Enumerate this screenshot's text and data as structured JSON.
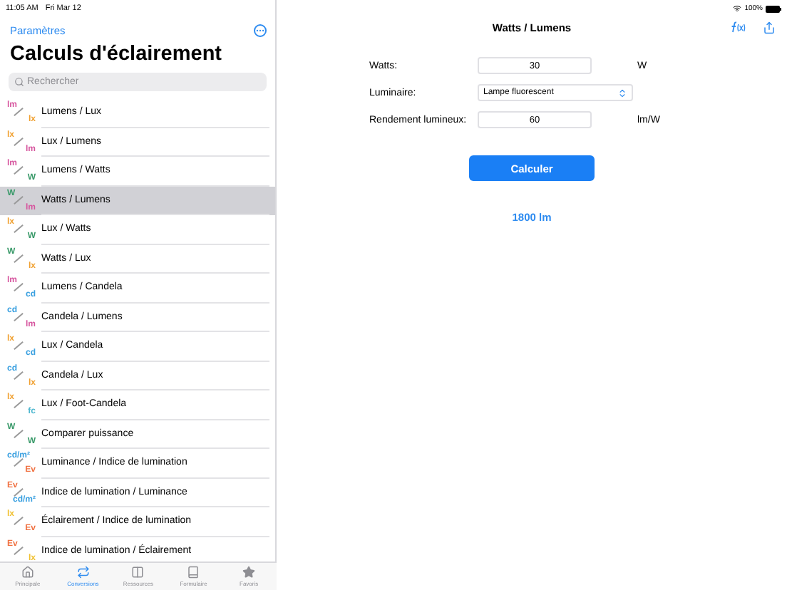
{
  "status_bar": {
    "time": "11:05 AM",
    "date": "Fri Mar 12",
    "battery": "100%"
  },
  "sidebar": {
    "back_link": "Paramètres",
    "title": "Calculs d'éclairement",
    "search": {
      "placeholder": "Rechercher"
    },
    "items": [
      {
        "label": "Lumens / Lux",
        "top": {
          "text": "lm",
          "color": "#d6559e"
        },
        "bottom": {
          "text": "lx",
          "color": "#f0a030"
        },
        "selected": false
      },
      {
        "label": "Lux / Lumens",
        "top": {
          "text": "lx",
          "color": "#f0a030"
        },
        "bottom": {
          "text": "lm",
          "color": "#d6559e"
        },
        "selected": false
      },
      {
        "label": "Lumens / Watts",
        "top": {
          "text": "lm",
          "color": "#d6559e"
        },
        "bottom": {
          "text": "W",
          "color": "#3a9a6a"
        },
        "selected": false
      },
      {
        "label": "Watts / Lumens",
        "top": {
          "text": "W",
          "color": "#3a9a6a"
        },
        "bottom": {
          "text": "lm",
          "color": "#d6559e"
        },
        "selected": true
      },
      {
        "label": "Lux / Watts",
        "top": {
          "text": "lx",
          "color": "#f0a030"
        },
        "bottom": {
          "text": "W",
          "color": "#3a9a6a"
        },
        "selected": false
      },
      {
        "label": "Watts / Lux",
        "top": {
          "text": "W",
          "color": "#3a9a6a"
        },
        "bottom": {
          "text": "lx",
          "color": "#f0a030"
        },
        "selected": false
      },
      {
        "label": "Lumens / Candela",
        "top": {
          "text": "lm",
          "color": "#d6559e"
        },
        "bottom": {
          "text": "cd",
          "color": "#3aa0e0"
        },
        "selected": false
      },
      {
        "label": "Candela / Lumens",
        "top": {
          "text": "cd",
          "color": "#3aa0e0"
        },
        "bottom": {
          "text": "lm",
          "color": "#d6559e"
        },
        "selected": false
      },
      {
        "label": "Lux / Candela",
        "top": {
          "text": "lx",
          "color": "#f0a030"
        },
        "bottom": {
          "text": "cd",
          "color": "#3aa0e0"
        },
        "selected": false
      },
      {
        "label": "Candela / Lux",
        "top": {
          "text": "cd",
          "color": "#3aa0e0"
        },
        "bottom": {
          "text": "lx",
          "color": "#f0a030"
        },
        "selected": false
      },
      {
        "label": "Lux / Foot-Candela",
        "top": {
          "text": "lx",
          "color": "#f0a030"
        },
        "bottom": {
          "text": "fc",
          "color": "#50b8d0"
        },
        "selected": false
      },
      {
        "label": "Comparer puissance",
        "top": {
          "text": "W",
          "color": "#3a9a6a"
        },
        "bottom": {
          "text": "W",
          "color": "#3a9a6a"
        },
        "selected": false
      },
      {
        "label": "Luminance / Indice de lumination",
        "top": {
          "text": "cd/m²",
          "color": "#3aa0e0"
        },
        "bottom": {
          "text": "Ev",
          "color": "#f07040"
        },
        "selected": false
      },
      {
        "label": "Indice de lumination / Luminance",
        "top": {
          "text": "Ev",
          "color": "#f07040"
        },
        "bottom": {
          "text": "cd/m²",
          "color": "#3aa0e0"
        },
        "selected": false
      },
      {
        "label": "Éclairement / Indice de lumination",
        "top": {
          "text": "lx",
          "color": "#f0c030"
        },
        "bottom": {
          "text": "Ev",
          "color": "#f07040"
        },
        "selected": false
      },
      {
        "label": "Indice de lumination / Éclairement",
        "top": {
          "text": "Ev",
          "color": "#f07040"
        },
        "bottom": {
          "text": "lx",
          "color": "#f0c030"
        },
        "selected": false
      }
    ]
  },
  "tab_bar": [
    {
      "label": "Principale",
      "selected": false,
      "kind": "home"
    },
    {
      "label": "Conversions",
      "selected": true,
      "kind": "convert"
    },
    {
      "label": "Ressources",
      "selected": false,
      "kind": "table"
    },
    {
      "label": "Formulaire",
      "selected": false,
      "kind": "book"
    },
    {
      "label": "Favoris",
      "selected": false,
      "kind": "star"
    }
  ],
  "detail": {
    "title": "Watts / Lumens",
    "fields": [
      {
        "kind": "input",
        "label": "Watts:",
        "value": "30",
        "unit": "W"
      },
      {
        "kind": "select",
        "label": "Luminaire:",
        "value": "Lampe fluorescent"
      },
      {
        "kind": "input",
        "label": "Rendement lumineux:",
        "value": "60",
        "unit": "lm/W"
      }
    ],
    "button": "Calculer",
    "result": "1800 lm"
  }
}
